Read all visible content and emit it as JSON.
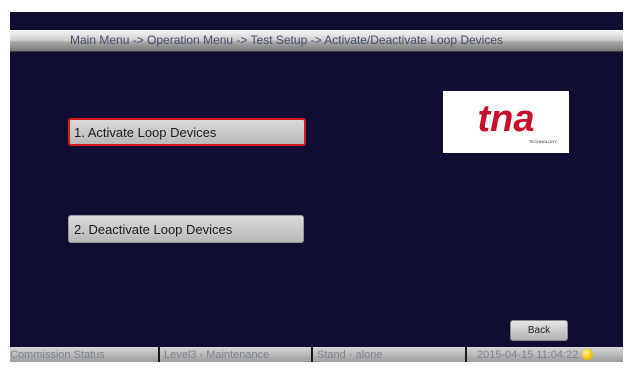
{
  "header": {
    "breadcrumb": "Main Menu -> Operation Menu -> Test Setup -> Activate/Deactivate Loop Devices"
  },
  "menu": {
    "items": [
      {
        "label": "1. Activate Loop Devices",
        "selected": true
      },
      {
        "label": "2. Deactivate Loop Devices",
        "selected": false
      }
    ]
  },
  "logo": {
    "text": "tna",
    "subtext": "TECHNOLOGY",
    "color": "#c8102e"
  },
  "back_label": "Back",
  "status": {
    "commission": "Commission Status",
    "level": "Level3 - Maintenance",
    "mode": "Stand - alone",
    "datetime": "2015-04-15 11:04:22",
    "indicator_color": "#f3c400"
  },
  "colors": {
    "background": "#100d33",
    "selected_border": "#d11a1a"
  }
}
